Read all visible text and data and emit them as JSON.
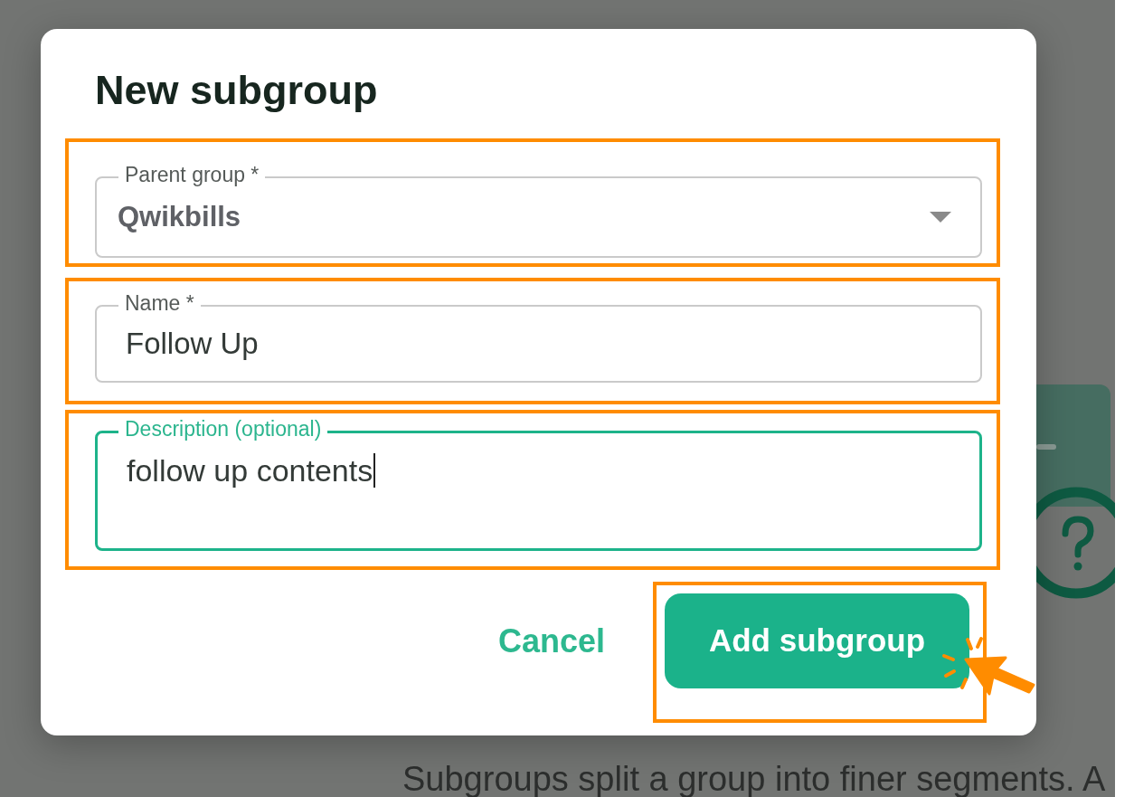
{
  "dialog": {
    "title": "New subgroup",
    "fields": [
      {
        "kind": "select",
        "label": "Parent group *",
        "value": "Qwikbills",
        "focused": false,
        "highlighted": true
      },
      {
        "kind": "text",
        "label": "Name *",
        "value": "Follow Up",
        "focused": false,
        "highlighted": true
      },
      {
        "kind": "textarea",
        "label": "Description (optional)",
        "value": "follow up contents",
        "focused": true,
        "highlighted": true
      }
    ],
    "buttons": [
      {
        "kind": "text",
        "label": "Cancel",
        "highlighted": false,
        "clicked": false
      },
      {
        "kind": "primary",
        "label": "Add subgroup",
        "highlighted": true,
        "clicked": true
      }
    ]
  },
  "background": {
    "description": "Subgroups split a group into finer segments. A"
  }
}
